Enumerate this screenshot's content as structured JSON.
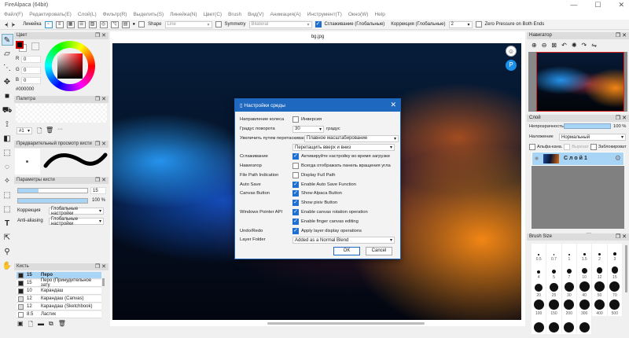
{
  "window": {
    "title": "FireAlpaca (64bit)",
    "controls": [
      "—",
      "☐",
      "✕"
    ]
  },
  "menu": [
    "Файл(F)",
    "Редактировать(E)",
    "Слой(L)",
    "Фильтр(R)",
    "Выделить(S)",
    "Линейка(N)",
    "Цвет(C)",
    "Brush",
    "Вид(V)",
    "Анимация(A)",
    "Инструмент(T)",
    "Окно(W)",
    "Help"
  ],
  "toolbar": {
    "ruler_label": "Линейка",
    "shape_label": "Shape",
    "shape_value": "Line",
    "symmetry_label": "Symmetry",
    "symmetry_value": "Bilateral",
    "smoothing_label": "Сглаживание (Глобальные)",
    "correction_label": "Коррекция (Глобальные)",
    "correction_value": "2",
    "zero_pressure_label": "Zero Pressure on Both Ends"
  },
  "color_panel": {
    "title": "Цвет",
    "r_label": "R",
    "g_label": "G",
    "b_label": "B",
    "r": "0",
    "g": "0",
    "b": "0",
    "hex": "#000000",
    "primary": "#000000"
  },
  "palette_panel": {
    "title": "Палитра",
    "set": "#1"
  },
  "brush_preview_panel": {
    "title": "Предварительный просмотр кисти"
  },
  "brush_params_panel": {
    "title": "Параметры кисти",
    "size": "15",
    "opacity": "100 %",
    "size_fill": 0.3,
    "opacity_fill": 1.0,
    "correction_label": "Коррекция",
    "correction_value": "Глобальные настройки",
    "aa_label": "Anti-aliasing",
    "aa_value": "Глобальные настройки"
  },
  "brush_panel": {
    "title": "Кисть",
    "items": [
      {
        "size": "15",
        "name": "Перо",
        "selected": true,
        "color": "#222"
      },
      {
        "size": "15",
        "name": "Перо (Принудительное зату",
        "color": "#222"
      },
      {
        "size": "10",
        "name": "Карандаш",
        "color": "#222"
      },
      {
        "size": "12",
        "name": "Карандаш (Canvas)",
        "color": "#ddd"
      },
      {
        "size": "12",
        "name": "Карандаш (Sketchbook)",
        "color": "#ddd"
      },
      {
        "size": "8.5",
        "name": "Ластик",
        "color": "#fff"
      }
    ]
  },
  "canvas": {
    "tab": "bg.jpg"
  },
  "dialog": {
    "title": "Настройки среды",
    "rows": [
      {
        "label": "Направление колеса",
        "type": "check",
        "checked": false,
        "text": "Инверсия"
      },
      {
        "label": "Градус поворота",
        "type": "selectunit",
        "value": "30",
        "unit": "градус"
      },
      {
        "label": "Увеличить путем перетаскивания",
        "type": "select",
        "value": "Плавное масштабирование"
      },
      {
        "label": "",
        "type": "select",
        "value": "Перетащить вверх и вниз"
      },
      {
        "label": "Сглаживание",
        "type": "check",
        "checked": true,
        "text": "Активируйте настройку во время загрузки"
      },
      {
        "label": "Навигатор",
        "type": "check",
        "checked": false,
        "text": "Всегда отображать панель вращения угла"
      },
      {
        "label": "File Path Indication",
        "type": "check",
        "checked": false,
        "text": "Display Full Path"
      },
      {
        "label": "Auto Save",
        "type": "check",
        "checked": true,
        "text": "Enable Auto Save Function"
      },
      {
        "label": "Canvas Button",
        "type": "check",
        "checked": true,
        "text": "Show Alpaca Button"
      },
      {
        "label": "",
        "type": "check",
        "checked": true,
        "text": "Show pixiv Button"
      },
      {
        "label": "Windows Pointer API",
        "type": "check",
        "checked": true,
        "text": "Enable canvas rotation operation"
      },
      {
        "label": "",
        "type": "check",
        "checked": true,
        "text": "Enable finger canvas editing"
      },
      {
        "label": "Undo/Redo",
        "type": "check",
        "checked": true,
        "text": "Apply layer display operations"
      },
      {
        "label": "Layer Folder",
        "type": "select",
        "value": "Added as a Normal Blend"
      }
    ],
    "ok": "OK",
    "cancel": "Cancel"
  },
  "navigator": {
    "title": "Навигатор"
  },
  "layer_panel": {
    "title": "Слой",
    "opacity_label": "Непрозрачность",
    "opacity": "100 %",
    "blend_label": "Наложение",
    "blend_value": "Нормальный",
    "alpha_label": "Альфа-кана.",
    "clip_label": "Вырезат",
    "lock_label": "Заблокироват",
    "layer_name": "Слой1"
  },
  "brush_size_panel": {
    "title": "Brush Size",
    "sizes": [
      "0.5",
      "0.7",
      "1",
      "1.5",
      "2",
      "3",
      "4",
      "5",
      "7",
      "10",
      "12",
      "15",
      "20",
      "25",
      "30",
      "40",
      "50",
      "70",
      "100",
      "150",
      "200",
      "300",
      "400",
      "500"
    ]
  },
  "colors": {
    "accent": "#1f68c0",
    "selection": "#a8d4f5"
  }
}
